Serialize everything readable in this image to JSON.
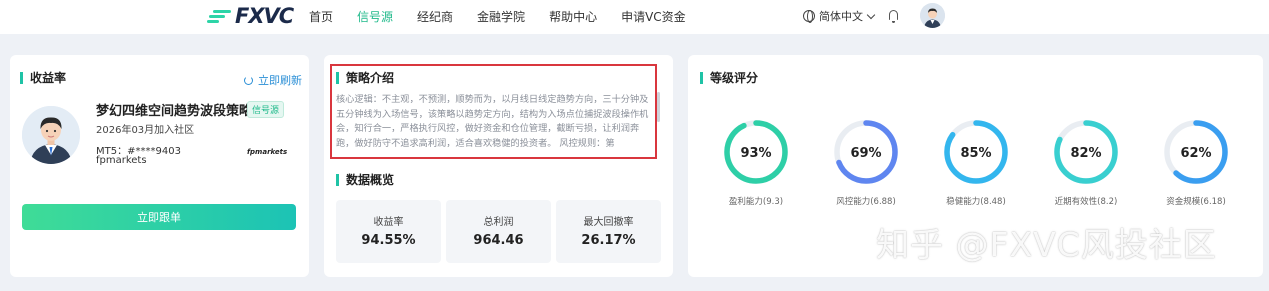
{
  "brand": {
    "name": "FXVC"
  },
  "nav": [
    "首页",
    "信号源",
    "经纪商",
    "金融学院",
    "帮助中心",
    "申请VC资金"
  ],
  "nav_active_index": 1,
  "header": {
    "language": "简体中文"
  },
  "profile_card": {
    "title": "收益率",
    "refresh_label": "立即刷新",
    "strategy_name": "梦幻四维空间趋势波段策略",
    "badge": "信号源",
    "join_date": "2026年03月加入社区",
    "mt5": "MT5：#****9403",
    "broker": "fpmarkets",
    "broker_logo": "fpmarkets",
    "follow_button": "立即跟单"
  },
  "intro_card": {
    "title": "策略介绍",
    "text": "核心逻辑：不主观，不预测，顺势而为，以月线日线定趋势方向，三十分钟及五分钟线为入场信号，该策略以趋势定方向，结构为入场点位捕捉波段操作机会，知行合一，严格执行风控，做好资金和仓位管理，截断亏损，让利润奔跑，做好防守不追求高利润，适合喜欢稳健的投资者。 风控规则：第"
  },
  "overview": {
    "title": "数据概览",
    "stats": [
      {
        "label": "收益率",
        "value": "94.55%"
      },
      {
        "label": "总利润",
        "value": "964.46"
      },
      {
        "label": "最大回撤率",
        "value": "26.17%"
      }
    ]
  },
  "rating": {
    "title": "等级评分",
    "items": [
      {
        "value": 93,
        "display": "93%",
        "label": "盈利能力(9.3)",
        "color": "#2ecfa7"
      },
      {
        "value": 69,
        "display": "69%",
        "label": "风控能力(6.88)",
        "color": "#5f86f0"
      },
      {
        "value": 85,
        "display": "85%",
        "label": "稳健能力(8.48)",
        "color": "#33b6ee"
      },
      {
        "value": 82,
        "display": "82%",
        "label": "近期有效性(8.2)",
        "color": "#39cfd0"
      },
      {
        "value": 62,
        "display": "62%",
        "label": "资金规模(6.18)",
        "color": "#3a9ef0"
      }
    ]
  },
  "watermark": "知乎 @FXVC风投社区"
}
